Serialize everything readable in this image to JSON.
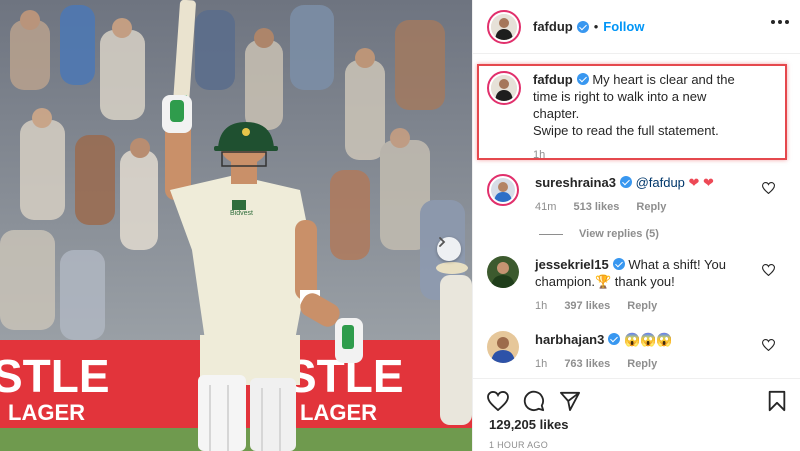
{
  "post": {
    "username": "fafdup",
    "follow_label": "Follow",
    "separator": "•"
  },
  "caption": {
    "username": "fafdup",
    "line1": "My heart is clear and the",
    "line2": "time is right to walk into a new",
    "line3": "chapter.",
    "line4": "Swipe to read the full statement.",
    "time": "1h"
  },
  "comments": [
    {
      "username": "sureshraina3",
      "mention": "@fafdup",
      "text": "",
      "hearts": "❤ ❤",
      "time": "41m",
      "likes": "513 likes",
      "reply": "Reply",
      "view_replies": "View replies (5)"
    },
    {
      "username": "jessekriel15",
      "text": "What a shift! You",
      "text2": "champion.",
      "trophy": "🏆",
      "text3": " thank you!",
      "time": "1h",
      "likes": "397 likes",
      "reply": "Reply"
    },
    {
      "username": "harbhajan3",
      "emoji": "😱😱😱",
      "time": "1h",
      "likes": "763 likes",
      "reply": "Reply"
    }
  ],
  "footer": {
    "likes": "129,205 likes",
    "time": "1 HOUR AGO"
  },
  "photo_text": {
    "banner_left": "STLE",
    "banner_left_sub": "LAGER",
    "banner_right": "STLE",
    "banner_right_sub": "LAGER",
    "shirt_sponsor": "Bidvest"
  },
  "colors": {
    "follow": "#0095f6",
    "verified": "#3897f0",
    "highlight": "#e5484d",
    "banner": "#e2343b"
  },
  "icons": [
    "verified-badge",
    "more-options-icon",
    "heart-outline-icon",
    "comment-icon",
    "share-icon",
    "save-icon",
    "next-arrow-icon"
  ]
}
